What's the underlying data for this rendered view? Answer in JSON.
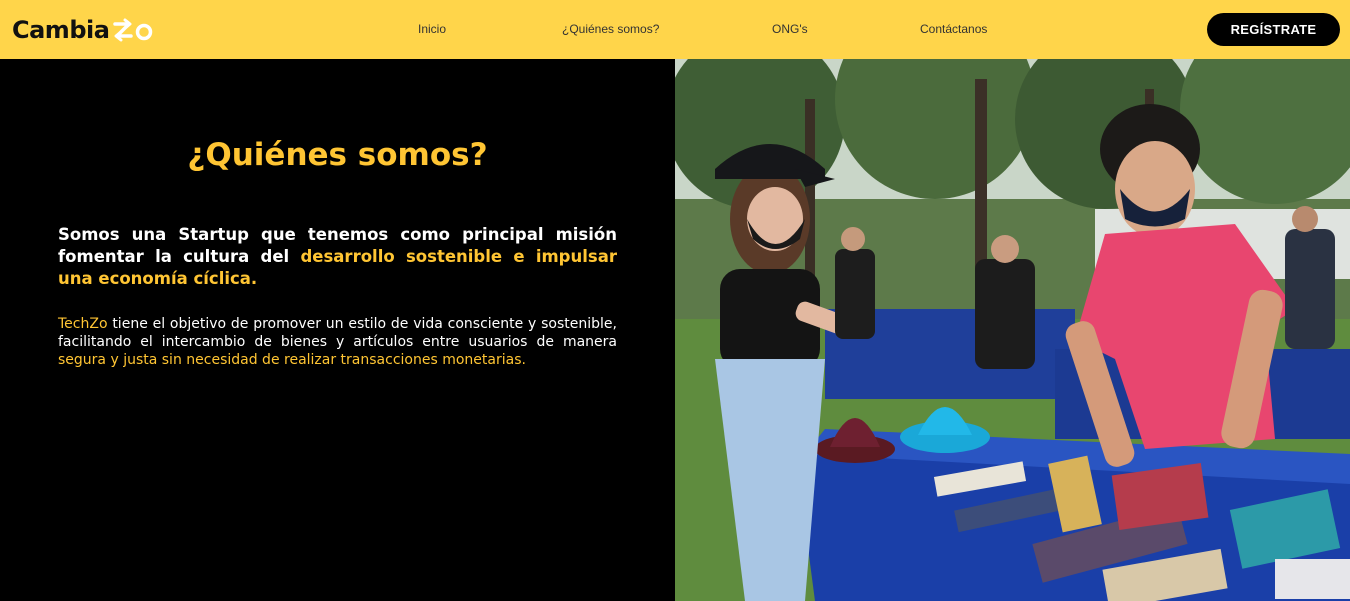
{
  "header": {
    "logo_text": "Cambia",
    "logo_icon": "swap-arrows-zo-icon",
    "nav": [
      {
        "label": "Inicio"
      },
      {
        "label": "¿Quiénes somos?"
      },
      {
        "label": "ONG's"
      },
      {
        "label": "Contáctanos"
      }
    ],
    "register_label": "REGÍSTRATE"
  },
  "about": {
    "title": "¿Quiénes somos?",
    "mission_prefix": "Somos una Startup que tenemos como principal misión fomentar la cultura del ",
    "mission_highlight": "desarrollo sostenible e impulsar una economía cíclica.",
    "desc_brand": "TechZo",
    "desc_text": " tiene el objetivo de promover un estilo de vida consciente y sostenible, facilitando el intercambio de bienes y artículos entre usuarios de manera ",
    "desc_highlight": "segura y justa sin necesidad de realizar transacciones monetarias."
  },
  "colors": {
    "header_bg": "#ffd54a",
    "accent": "#ffc533",
    "background": "#000000",
    "button_bg": "#000000",
    "button_text": "#ffffff"
  },
  "photo": {
    "icon": "book-exchange-photo"
  }
}
